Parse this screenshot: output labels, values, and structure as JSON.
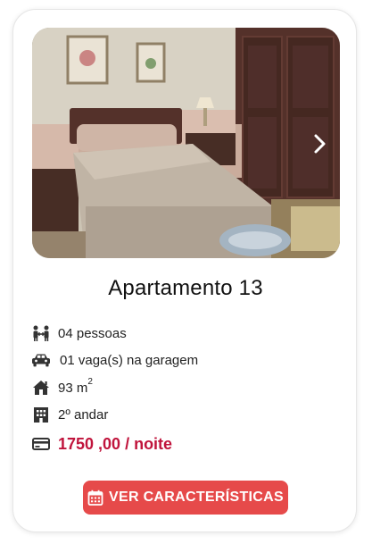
{
  "listing": {
    "title": "Apartamento 13",
    "features": {
      "people": "04 pessoas",
      "parking": "01 vaga(s) na garagem",
      "area_value": "93 m",
      "area_unit_exp": "2",
      "floor": "2º andar",
      "price": "1750 ,00 / noite"
    },
    "cta_label": "VER CARACTERÍSTICAS"
  },
  "icons": {
    "people": "people-icon",
    "parking": "car-icon",
    "area": "house-icon",
    "floor": "building-icon",
    "price": "credit-card-icon",
    "cta": "calendar-icon",
    "carousel_next": "chevron-right-icon"
  },
  "colors": {
    "price": "#c0143c",
    "cta_bg": "#e64a4a",
    "icon": "#333333"
  }
}
